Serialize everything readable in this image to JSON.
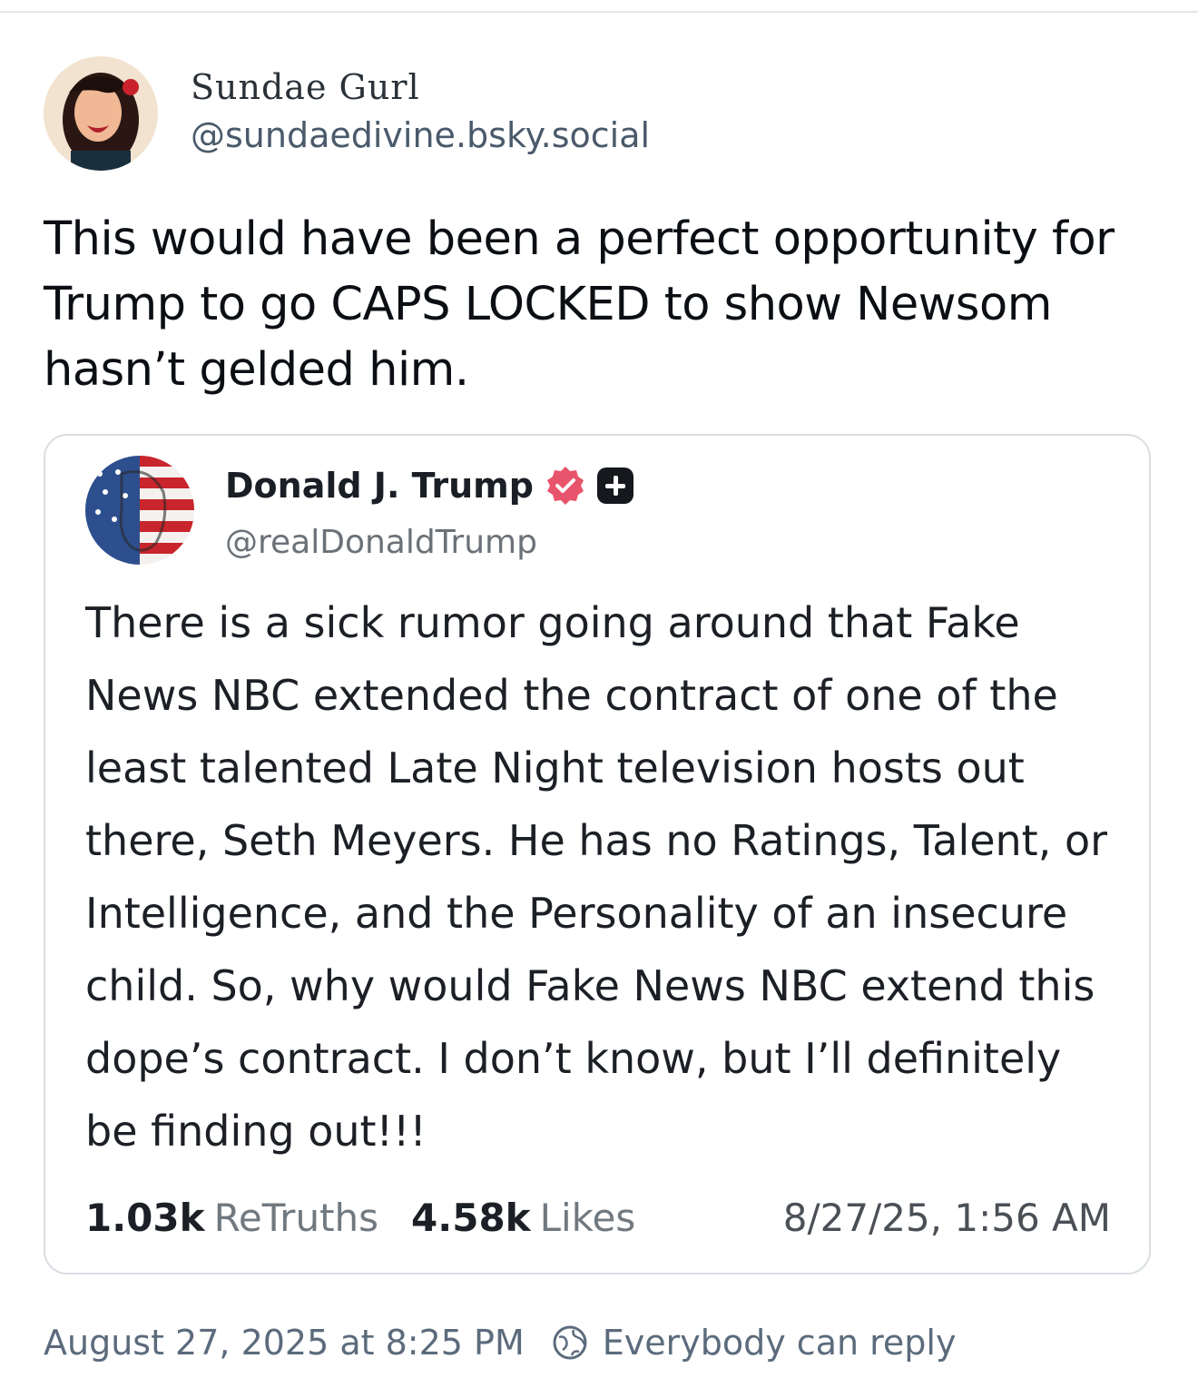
{
  "post": {
    "author": {
      "display_name": "Sundae Gurl",
      "handle": "@sundaedivine.bsky.social"
    },
    "text": "This would have been a perfect opportunity for Trump to go CAPS LOCKED to show Newsom hasn’t gelded him.",
    "timestamp": "August 27, 2025 at 8:25 PM",
    "reply_setting": "Everybody can reply"
  },
  "quoted_post": {
    "author": {
      "display_name": "Donald J. Trump",
      "handle": "@realDonaldTrump"
    },
    "text": "There is a sick rumor going around that Fake News NBC extended the contract of one of the least talented Late Night television hosts out there, Seth Meyers. He has no Ratings, Talent, or Intelligence, and the Personality of an insecure child. So, why would Fake News NBC extend this dope’s contract. I don’t know, but I’ll definitely be finding out!!!",
    "stats": {
      "retruths_count": "1.03k",
      "retruths_label": "ReTruths",
      "likes_count": "4.58k",
      "likes_label": "Likes"
    },
    "timestamp": "8/27/25, 1:56 AM"
  },
  "colors": {
    "verified_badge": "#e8546b",
    "card_border": "#d9dee3",
    "muted_text": "#5b6b7c"
  },
  "icons": {
    "verified": "verified-badge-icon",
    "plus": "plus-square-icon",
    "reply_setting": "globe-icon"
  }
}
